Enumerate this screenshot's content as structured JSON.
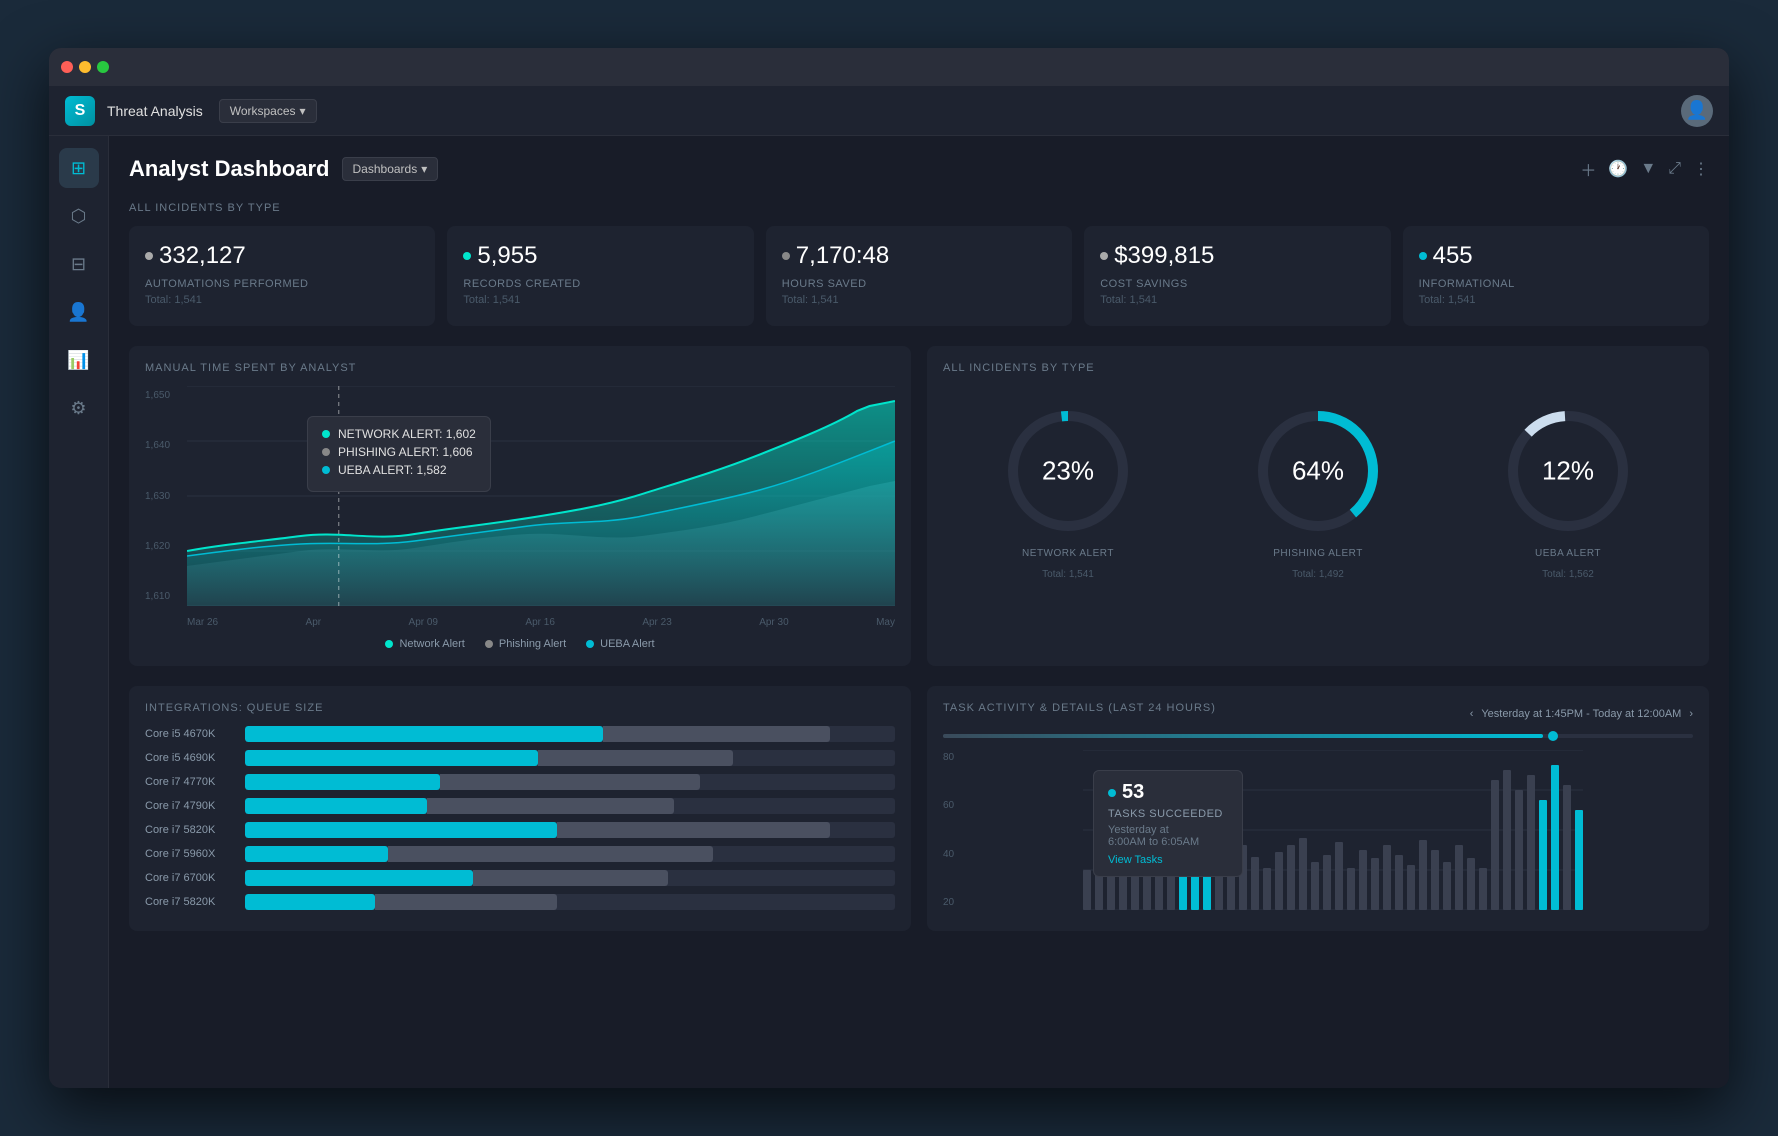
{
  "window": {
    "title": "Threat Analysis"
  },
  "appbar": {
    "logo": "S",
    "title": "Threat Analysis",
    "workspace": "Workspaces"
  },
  "sidebar": {
    "items": [
      {
        "id": "dashboard",
        "icon": "⊞",
        "label": "Dashboard"
      },
      {
        "id": "cube",
        "icon": "⬡",
        "label": "Cube"
      },
      {
        "id": "grid",
        "icon": "⊟",
        "label": "Grid"
      },
      {
        "id": "users",
        "icon": "👤",
        "label": "Users"
      },
      {
        "id": "chart",
        "icon": "📊",
        "label": "Chart"
      },
      {
        "id": "settings",
        "icon": "⚙",
        "label": "Settings"
      }
    ]
  },
  "page": {
    "title": "Analyst Dashboard",
    "dashboards_label": "Dashboards"
  },
  "stats_section": {
    "label": "ALL INCIDENTS BY TYPE",
    "cards": [
      {
        "value": "332,127",
        "label": "AUTOMATIONS PERFORMED",
        "total": "Total: 1,541",
        "dot_color": "#aaaaaa"
      },
      {
        "value": "5,955",
        "label": "RECORDS CREATED",
        "total": "Total: 1,541",
        "dot_color": "#00e5cc"
      },
      {
        "value": "7,170:48",
        "label": "HOURS SAVED",
        "total": "Total: 1,541",
        "dot_color": "#888888"
      },
      {
        "value": "$399,815",
        "label": "COST SAVINGS",
        "total": "Total: 1,541",
        "dot_color": "#aaaaaa"
      },
      {
        "value": "455",
        "label": "INFORMATIONAL",
        "total": "Total: 1,541",
        "dot_color": "#00bcd4"
      }
    ]
  },
  "area_chart": {
    "title": "MANUAL TIME SPENT BY ANALYST",
    "y_labels": [
      "1,650",
      "1,640",
      "1,630",
      "1,620",
      "1,610"
    ],
    "x_labels": [
      "Mar 26",
      "Apr",
      "Apr 09",
      "Apr 16",
      "Apr 23",
      "Apr 30",
      "May"
    ],
    "tooltip": {
      "network_alert": "NETWORK ALERT: 1,602",
      "phishing_alert": "PHISHING ALERT: 1,606",
      "ueba_alert": "UEBA ALERT: 1,582"
    },
    "legend": [
      {
        "label": "Network Alert",
        "color": "#00e5cc"
      },
      {
        "label": "Phishing Alert",
        "color": "#888888"
      },
      {
        "label": "UEBA Alert",
        "color": "#00bcd4"
      }
    ]
  },
  "donut_chart": {
    "title": "ALL INCIDENTS BY TYPE",
    "items": [
      {
        "pct": "23%",
        "label": "NETWORK ALERT",
        "total": "Total: 1,541",
        "color": "#00bcd4",
        "value": 23
      },
      {
        "pct": "64%",
        "label": "PHISHING ALERT",
        "total": "Total: 1,492",
        "color": "#00bcd4",
        "value": 64
      },
      {
        "pct": "12%",
        "label": "UEBA ALERT",
        "total": "Total: 1,562",
        "color": "#ccddee",
        "value": 12
      }
    ]
  },
  "integrations": {
    "title": "INTEGRATIONS: QUEUE SIZE",
    "bars": [
      {
        "label": "Core i5 4670K",
        "cyan": 55,
        "gray": 35
      },
      {
        "label": "Core i5 4690K",
        "cyan": 45,
        "gray": 30
      },
      {
        "label": "Core i7 4770K",
        "cyan": 30,
        "gray": 40
      },
      {
        "label": "Core i7 4790K",
        "cyan": 28,
        "gray": 38
      },
      {
        "label": "Core i7 5820K",
        "cyan": 48,
        "gray": 42
      },
      {
        "label": "Core i7 5960X",
        "cyan": 22,
        "gray": 50
      },
      {
        "label": "Core i7 6700K",
        "cyan": 35,
        "gray": 30
      },
      {
        "label": "Core i7 5820K",
        "cyan": 20,
        "gray": 28
      }
    ]
  },
  "task_chart": {
    "title": "TASK ACTIVITY & DETAILS (LAST 24 HOURS)",
    "date_range": "Yesterday at 1:45PM - Today at 12:00AM",
    "y_labels": [
      "80",
      "60",
      "40",
      "20"
    ],
    "tooltip": {
      "count": "53",
      "label": "TASKS SUCCEEDED",
      "time": "Yesterday at\n6:00AM to 6:05AM",
      "link": "View Tasks"
    }
  }
}
